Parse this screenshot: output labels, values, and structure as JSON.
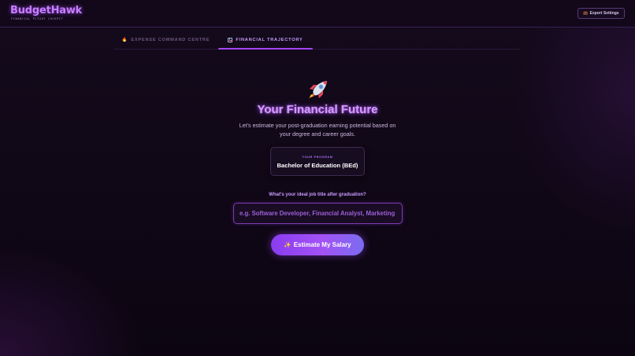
{
  "header": {
    "brand": "BudgetHawk",
    "tagline": "FINANCIAL FLIGHT COCKPIT",
    "export_icon": "briefcase-icon",
    "export_label": "Export Settings"
  },
  "tabs": [
    {
      "icon": "fire-icon",
      "label": "EXPENSE COMMAND CENTRE",
      "active": false
    },
    {
      "icon": "chart-icon",
      "label": "FINANCIAL TRAJECTORY",
      "active": true
    }
  ],
  "main": {
    "hero_icon": "rocket-icon",
    "title": "Your Financial Future",
    "subtitle": "Let's estimate your post-graduation earning potential based on your degree and career goals.",
    "program": {
      "label": "YOUR PROGRAM",
      "value": "Bachelor of Education (BEd)"
    },
    "question": "What's your ideal job title after graduation?",
    "job_input": {
      "value": "",
      "placeholder": "e.g. Software Developer, Financial Analyst, Marketing Manager"
    },
    "estimate_button": {
      "icon": "sparkles-icon",
      "label": "Estimate My Salary"
    }
  },
  "colors": {
    "accent": "#a347ff",
    "title_glow": "#d59bff",
    "background": "#0d0612"
  }
}
